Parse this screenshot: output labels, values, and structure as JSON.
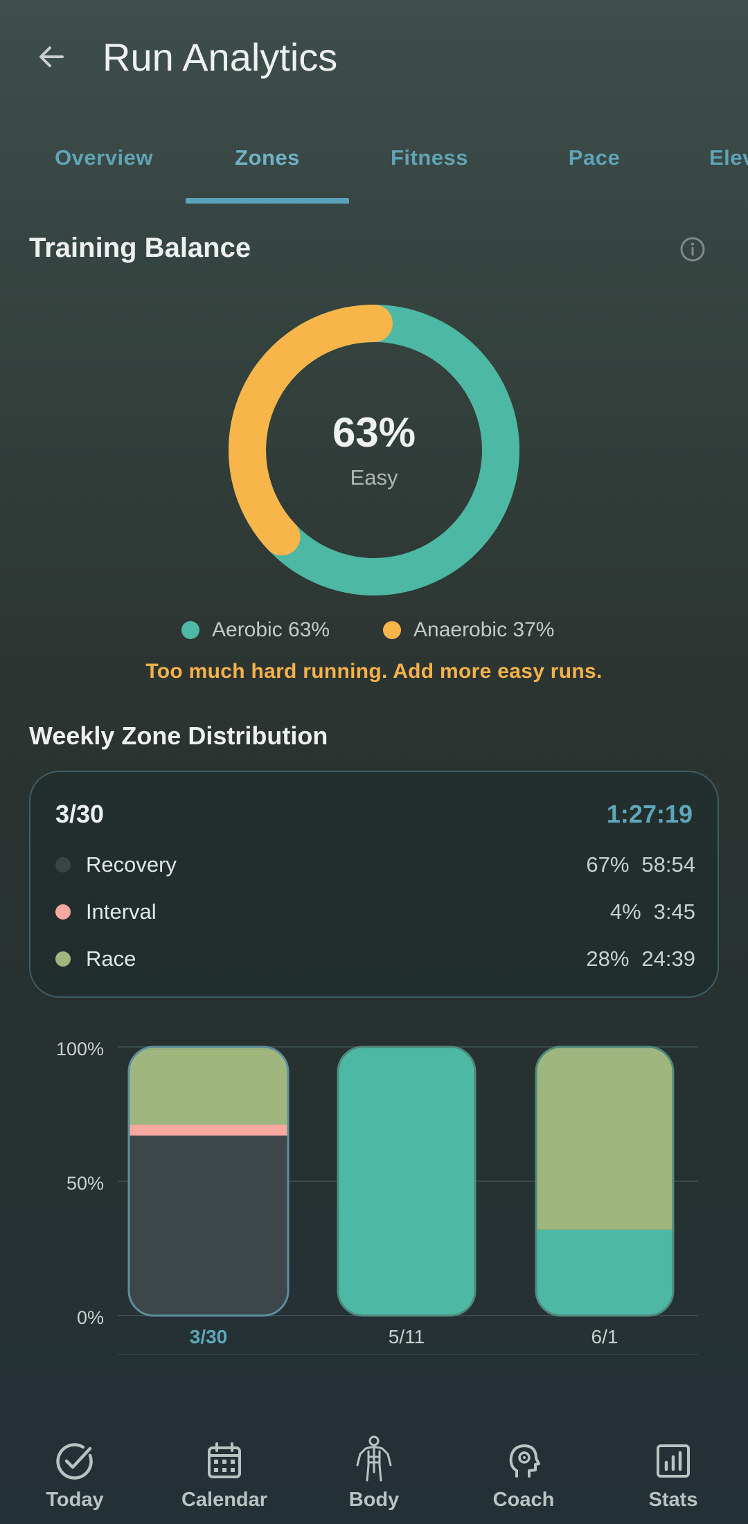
{
  "appbar": {
    "title": "Run Analytics",
    "back_icon": "arrow-left-icon"
  },
  "tabs": [
    {
      "label": "Overview"
    },
    {
      "label": "Zones",
      "active": true
    },
    {
      "label": "Fitness"
    },
    {
      "label": "Pace"
    },
    {
      "label": "Elev"
    }
  ],
  "training_balance": {
    "title": "Training Balance",
    "info_icon": "info-icon",
    "center_value": "63%",
    "center_label": "Easy",
    "aerobic_fraction": 0.63,
    "legend": [
      {
        "label": "Aerobic 63%",
        "color": "#4db8a4"
      },
      {
        "label": "Anaerobic 37%",
        "color": "#f8b54a"
      }
    ],
    "warning": "Too much hard running. Add more easy runs."
  },
  "weekly": {
    "title": "Weekly Zone Distribution",
    "card": {
      "week": "3/30",
      "total": "1:27:19",
      "rows": [
        {
          "name": "Recovery",
          "pct": "67%",
          "time": "58:54",
          "color": "#3a4447"
        },
        {
          "name": "Interval",
          "pct": "4%",
          "time": "3:45",
          "color": "#f7a8a0"
        },
        {
          "name": "Race",
          "pct": "28%",
          "time": "24:39",
          "color": "#a0b67f"
        }
      ]
    }
  },
  "chart_data": {
    "type": "bar",
    "stacked": true,
    "y_ticks": [
      "100%",
      "50%",
      "0%"
    ],
    "ylim": [
      0,
      100
    ],
    "categories": [
      "3/30",
      "5/11",
      "6/1"
    ],
    "selected_category": "3/30",
    "bars": [
      {
        "label": "3/30",
        "segments": [
          {
            "zone": "Recovery",
            "value": 67,
            "color": "#3d474a"
          },
          {
            "zone": "Interval",
            "value": 4,
            "color": "#f7a8a0"
          },
          {
            "zone": "Race",
            "value": 28,
            "color": "#a0b67f"
          }
        ]
      },
      {
        "label": "5/11",
        "segments": [
          {
            "zone": "Aerobic",
            "value": 100,
            "color": "#4db8a4"
          }
        ]
      },
      {
        "label": "6/1",
        "segments": [
          {
            "zone": "Aerobic",
            "value": 32,
            "color": "#4db8a4"
          },
          {
            "zone": "Race",
            "value": 68,
            "color": "#a0b67f"
          }
        ]
      }
    ]
  },
  "bottom_nav": [
    {
      "label": "Today",
      "icon": "check-circle-icon"
    },
    {
      "label": "Calendar",
      "icon": "calendar-icon"
    },
    {
      "label": "Body",
      "icon": "body-icon"
    },
    {
      "label": "Coach",
      "icon": "coach-head-icon"
    },
    {
      "label": "Stats",
      "icon": "stats-icon"
    }
  ]
}
